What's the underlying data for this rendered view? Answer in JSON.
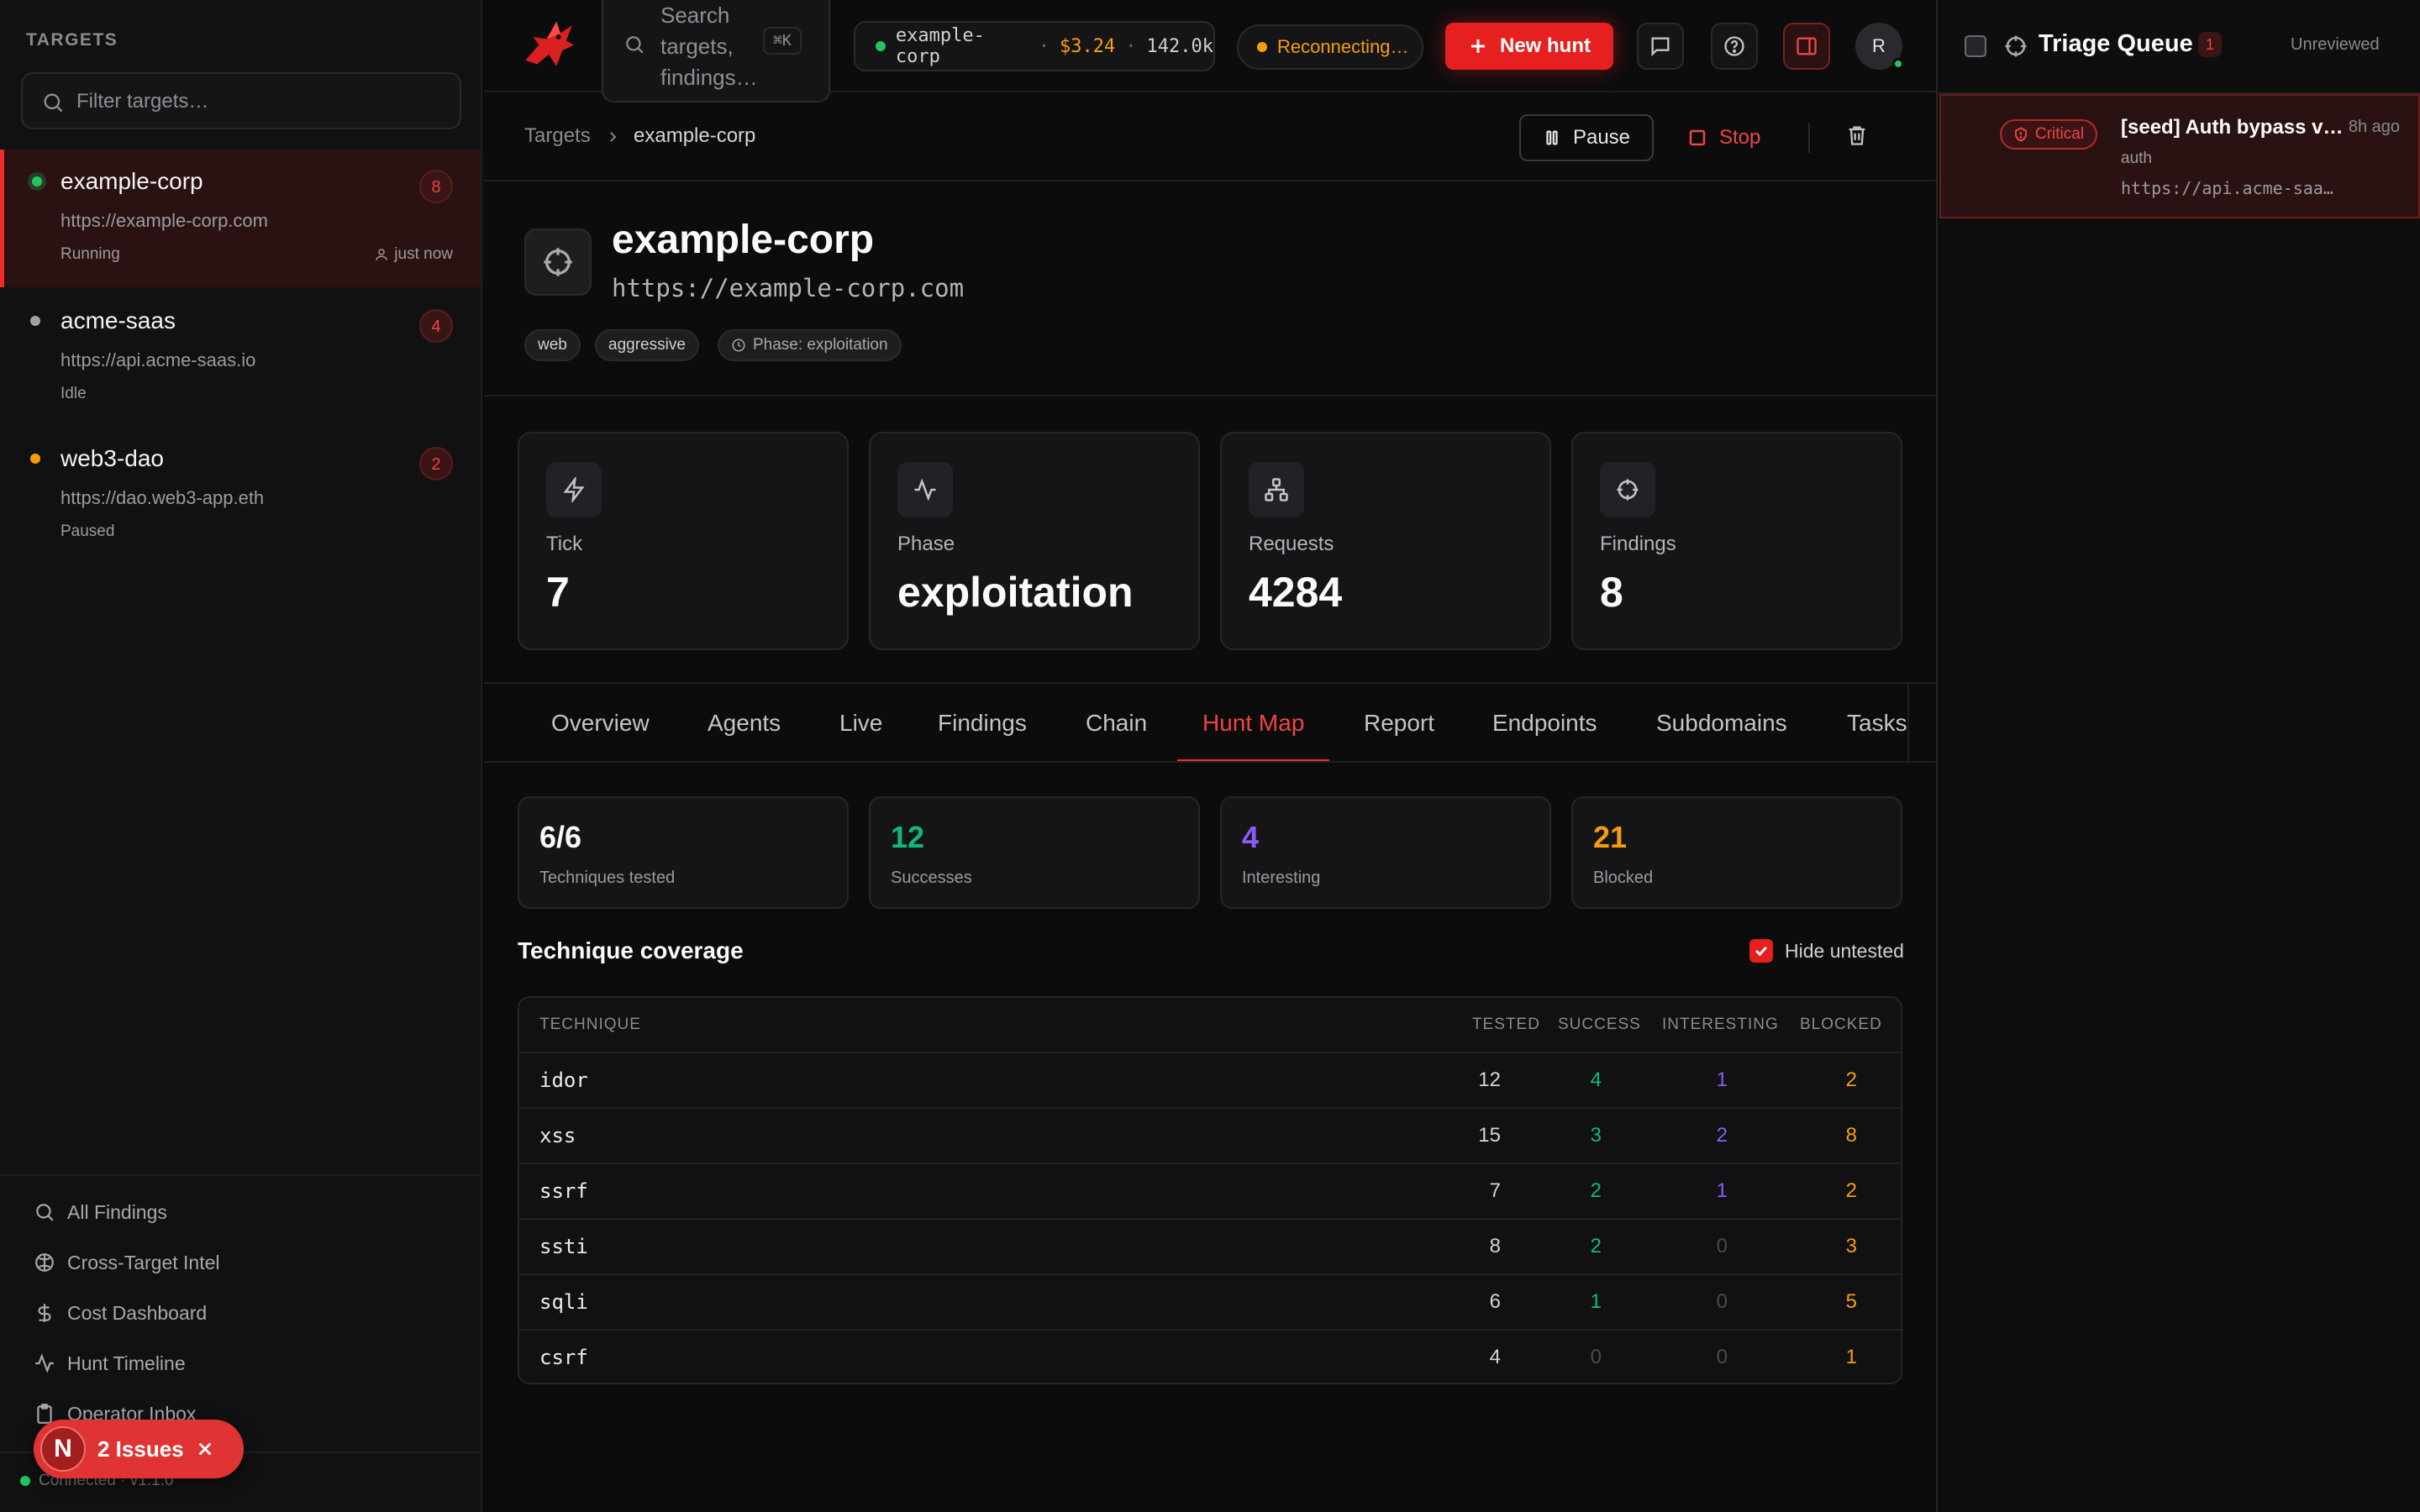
{
  "sidebar": {
    "heading": "TARGETS",
    "filter_placeholder": "Filter targets…",
    "targets": [
      {
        "name": "example-corp",
        "url": "https://example-corp.com",
        "status": "Running",
        "count": "8",
        "meta": "just now",
        "dot_color": "#22c55e"
      },
      {
        "name": "acme-saas",
        "url": "https://api.acme-saas.io",
        "status": "Idle",
        "count": "4",
        "dot_color": "#a1a1aa"
      },
      {
        "name": "web3-dao",
        "url": "https://dao.web3-app.eth",
        "status": "Paused",
        "count": "2",
        "dot_color": "#f59e0b"
      }
    ],
    "nav": [
      {
        "label": "All Findings",
        "icon": "search-icon"
      },
      {
        "label": "Cross-Target Intel",
        "icon": "brain-icon"
      },
      {
        "label": "Cost Dashboard",
        "icon": "dollar-icon"
      },
      {
        "label": "Hunt Timeline",
        "icon": "activity-icon"
      },
      {
        "label": "Operator Inbox",
        "icon": "clipboard-icon"
      }
    ],
    "connection": "Connected · v1.1.0",
    "issues": {
      "label": "2 Issues",
      "logo": "N"
    }
  },
  "topbar": {
    "search_placeholder": "Search targets, findings…",
    "search_shortcut": "⌘K",
    "status_target": "example-corp",
    "status_cost": "$3.24",
    "status_tokens": "142.0k",
    "reconnect": "Reconnecting…",
    "new_hunt": "New hunt",
    "avatar": "R"
  },
  "breadcrumb": {
    "root": "Targets",
    "current": "example-corp"
  },
  "actions": {
    "pause": "Pause",
    "stop": "Stop"
  },
  "header": {
    "title": "example-corp",
    "url": "https://example-corp.com",
    "tags": [
      "web",
      "aggressive"
    ],
    "phase_tag": "Phase: exploitation"
  },
  "stats": [
    {
      "label": "Tick",
      "value": "7",
      "icon": "zap-icon"
    },
    {
      "label": "Phase",
      "value": "exploitation",
      "icon": "activity-icon"
    },
    {
      "label": "Requests",
      "value": "4284",
      "icon": "network-icon"
    },
    {
      "label": "Findings",
      "value": "8",
      "icon": "crosshair-icon"
    }
  ],
  "tabs": [
    "Overview",
    "Agents",
    "Live",
    "Findings",
    "Chain",
    "Hunt Map",
    "Report",
    "Endpoints",
    "Subdomains",
    "Tasks"
  ],
  "active_tab": "Hunt Map",
  "summary": [
    {
      "value": "6/6",
      "label": "Techniques tested",
      "color": "#fafafa"
    },
    {
      "value": "12",
      "label": "Successes",
      "color": "#10b981"
    },
    {
      "value": "4",
      "label": "Interesting",
      "color": "#8b5cf6"
    },
    {
      "value": "21",
      "label": "Blocked",
      "color": "#f59e0b"
    }
  ],
  "coverage": {
    "title": "Technique coverage",
    "hide_untested": "Hide untested",
    "hide_untested_checked": true,
    "columns": [
      "TECHNIQUE",
      "TESTED",
      "SUCCESS",
      "INTERESTING",
      "BLOCKED"
    ],
    "rows": [
      {
        "technique": "idor",
        "tested": "12",
        "success": "4",
        "interesting": "1",
        "blocked": "2"
      },
      {
        "technique": "xss",
        "tested": "15",
        "success": "3",
        "interesting": "2",
        "blocked": "8"
      },
      {
        "technique": "ssrf",
        "tested": "7",
        "success": "2",
        "interesting": "1",
        "blocked": "2"
      },
      {
        "technique": "ssti",
        "tested": "8",
        "success": "2",
        "interesting": "0",
        "blocked": "3"
      },
      {
        "technique": "sqli",
        "tested": "6",
        "success": "1",
        "interesting": "0",
        "blocked": "5"
      },
      {
        "technique": "csrf",
        "tested": "4",
        "success": "0",
        "interesting": "0",
        "blocked": "1"
      }
    ]
  },
  "triage": {
    "title": "Triage Queue",
    "count": "1",
    "filter": "Unreviewed",
    "items": [
      {
        "severity": "Critical",
        "title": "[seed] Auth bypass v…",
        "time": "8h ago",
        "category": "auth",
        "url": "https://api.acme-saa…"
      }
    ]
  }
}
